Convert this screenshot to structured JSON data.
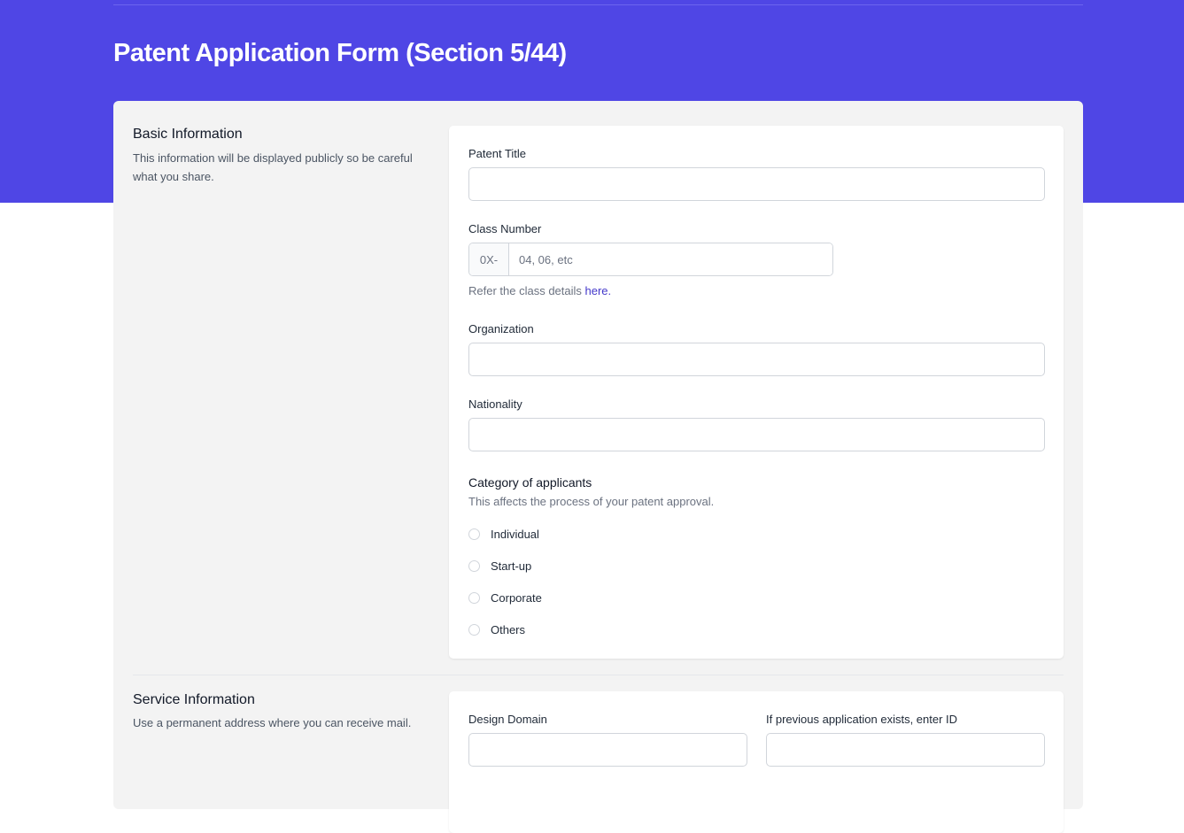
{
  "header": {
    "title": "Patent Application Form (Section 5/44)",
    "accent_color": "#4f46e5"
  },
  "basic_info": {
    "title": "Basic Information",
    "description": "This information will be displayed publicly so be careful what you share.",
    "patent_title": {
      "label": "Patent Title",
      "value": ""
    },
    "class_number": {
      "label": "Class Number",
      "prefix": "0X-",
      "placeholder": "04, 06, etc",
      "value": "",
      "help_text": "Refer the class details ",
      "help_link": "here."
    },
    "organization": {
      "label": "Organization",
      "value": ""
    },
    "nationality": {
      "label": "Nationality",
      "value": ""
    },
    "category": {
      "title": "Category of applicants",
      "description": "This affects the process of your patent approval.",
      "options": [
        "Individual",
        "Start-up",
        "Corporate",
        "Others"
      ],
      "selected": null
    }
  },
  "service_info": {
    "title": "Service Information",
    "description": "Use a permanent address where you can receive mail.",
    "design_domain": {
      "label": "Design Domain",
      "value": ""
    },
    "previous_application": {
      "label": "If previous application exists, enter ID",
      "value": ""
    }
  }
}
